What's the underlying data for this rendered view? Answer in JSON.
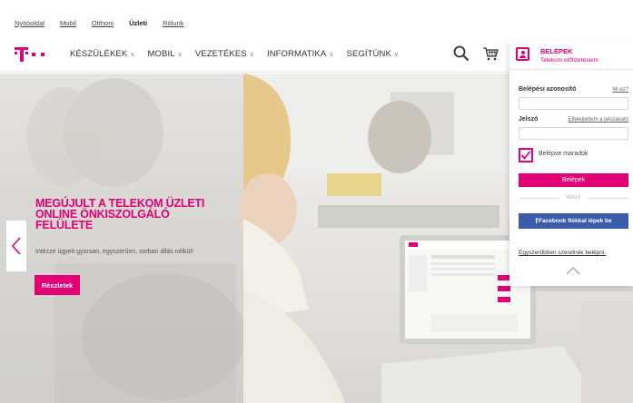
{
  "top_links": [
    {
      "label": "Nyitóoldal",
      "active": false
    },
    {
      "label": "Mobil",
      "active": false
    },
    {
      "label": "Otthoni",
      "active": false
    },
    {
      "label": "Üzleti",
      "active": true
    },
    {
      "label": "Rólunk",
      "active": false
    }
  ],
  "nav": {
    "menu": [
      "KÉSZÜLÉKEK",
      "MOBIL",
      "VEZETÉKES",
      "INFORMATIKA",
      "SEGÍTÜNK"
    ],
    "icons": [
      "search-icon",
      "cart-icon"
    ]
  },
  "hero": {
    "headline": "MEGÚJULT A TELEKOM ÜZLETI ONLINE ÖNKISZOLGÁLÓ FELÜLETE",
    "subtext": "Intézze ügyeit gyorsan, egyszerűen, sorban állás nélkül!",
    "button": "Részletek"
  },
  "login": {
    "title": "BELÉPEK",
    "subtitle": "Telekom előfizetéseim",
    "username_label": "Belépési azonosító",
    "whats_this": "Mi ez?",
    "password_label": "Jelszó",
    "forgot_password": "Elfelejtettem a jelszavam",
    "remember_me": "Belépve maradok",
    "submit": "Belépek",
    "or": "VAGY",
    "facebook_f": "f",
    "facebook_login": "Facebook fiókkal lépek be",
    "easier_login": "Egyszerűbben szeretnék belépni."
  },
  "colors": {
    "brand": "#e20074",
    "facebook": "#3b5bab"
  }
}
